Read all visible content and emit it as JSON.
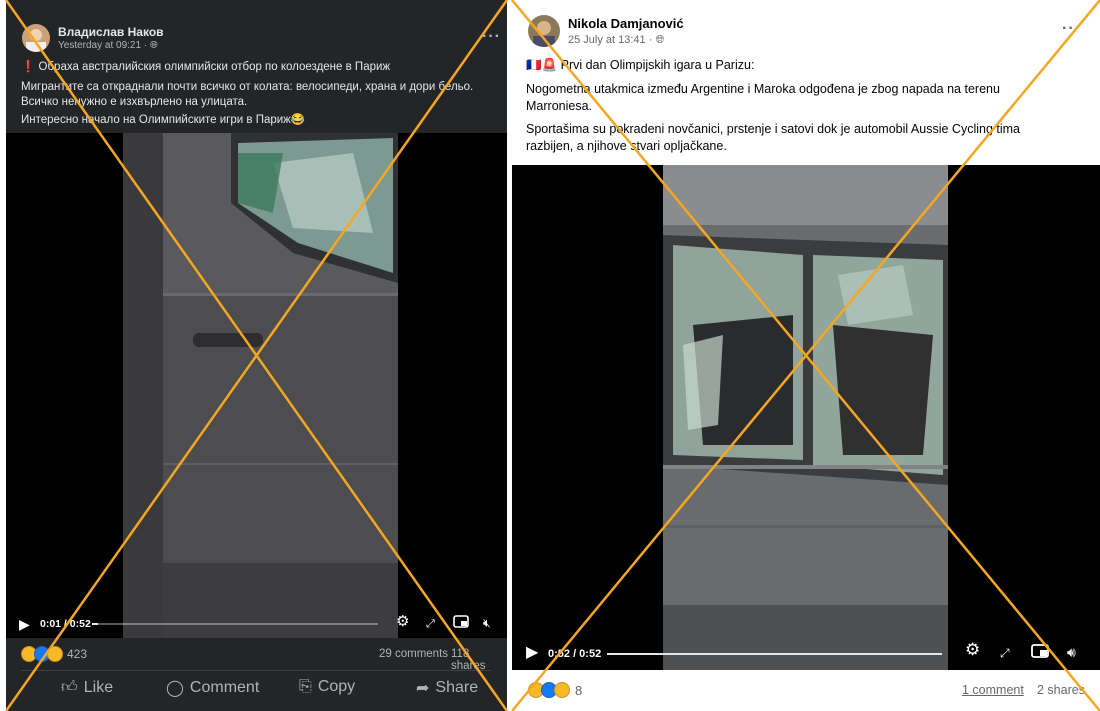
{
  "left_post": {
    "author": "Владислав Наков",
    "timestamp": "Yesterday at 09:21 · ",
    "title_line": "❗ Обраха австралийския олимпийски отбор по колоездене в Париж",
    "body_line1": "Мигрантите са откраднали почти всичко от колата: велосипеди, храна и дори бельо. Всичко ненужно е изхвърлено на улицата.",
    "body_line2": "Интересно начало на Олимпийските игри в Париж😂",
    "video_time": "0:01 / 0:52",
    "video_progress": 0.02,
    "reaction_count": "423",
    "comments": "29 comments",
    "shares": "118 shares",
    "actions": {
      "like": "Like",
      "comment": "Comment",
      "copy": "Copy",
      "share": "Share"
    },
    "colors": {
      "background": "#242526",
      "text": "#e4e6eb"
    }
  },
  "right_post": {
    "author": "Nikola Damjanović",
    "timestamp": "25 July at 13:41 · ",
    "title_line": "🇫🇷🚨 Prvi dan Olimpijskih igara u Parizu:",
    "body_line1": "Nogometna utakmica između Argentine i Maroka odgođena je zbog napada na terenu Marroniesa.",
    "body_line2": "Sportašima su pokradeni novčanici, prstenje i satovi dok je automobil Aussie Cycling tima razbijen, a njihove stvari opljačkane.",
    "video_time": "0:52 / 0:52",
    "video_progress": 1.0,
    "reaction_count": "8",
    "comments": "1 comment",
    "shares": "2 shares",
    "colors": {
      "background": "#ffffff",
      "text": "#050505"
    }
  },
  "overlay": {
    "mark": "cross",
    "color": "#f5a623"
  },
  "icons": [
    "globe-icon",
    "more-options-icon",
    "play-icon",
    "settings-icon",
    "fullscreen-icon",
    "pip-icon",
    "volume-icon",
    "like-icon",
    "comment-icon",
    "copy-icon",
    "share-icon"
  ]
}
